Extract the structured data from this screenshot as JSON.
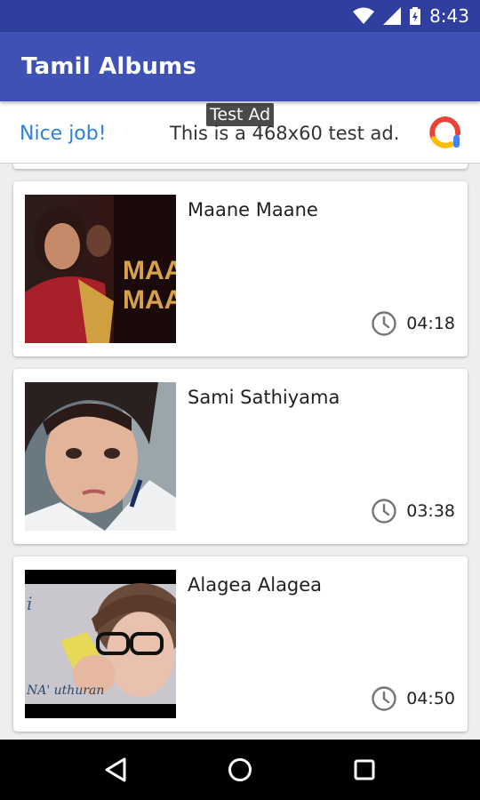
{
  "status_bar": {
    "time": "8:43",
    "icons": [
      "wifi-icon",
      "signal-icon",
      "battery-icon"
    ]
  },
  "app_bar": {
    "title": "Tamil Albums",
    "color": "#3f51b5"
  },
  "ad": {
    "label": "Test Ad",
    "headline": "Nice job!",
    "body": "This is a 468x60 test ad."
  },
  "songs": [
    {
      "title": "Maane Maane",
      "duration": "04:18",
      "thumbnail_text": [
        "MAA",
        "MAA"
      ]
    },
    {
      "title": "Sami Sathiyama",
      "duration": "03:38"
    },
    {
      "title": "Alagea Alagea",
      "duration": "04:50",
      "thumbnail_text": [
        "i",
        "NA' uthuran"
      ]
    }
  ],
  "nav_bar": {
    "buttons": [
      "back-icon",
      "home-icon",
      "recents-icon"
    ]
  }
}
